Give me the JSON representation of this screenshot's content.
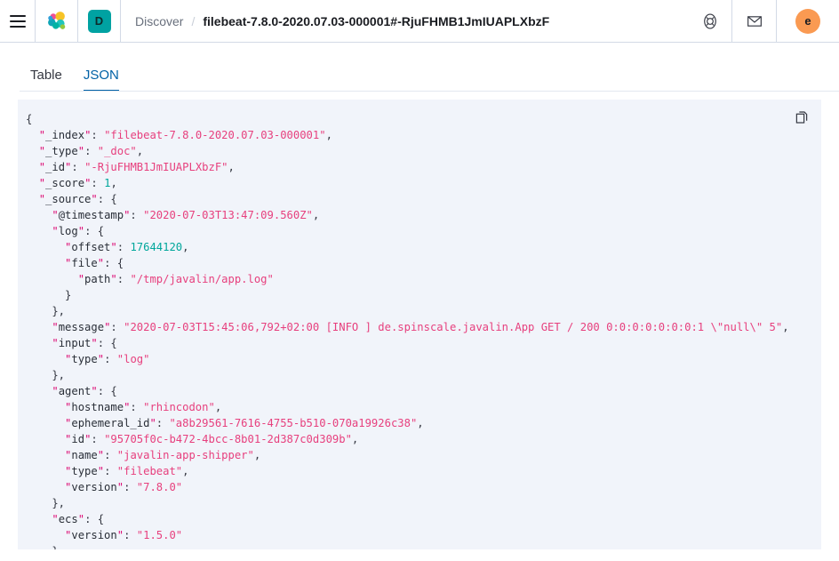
{
  "topbar": {
    "menu_label": "Toggle primary navigation",
    "logo_name": "elastic-logo",
    "space_badge": "D",
    "breadcrumb": {
      "parent": "Discover",
      "separator": "/",
      "current": "filebeat-7.8.0-2020.07.03-000001#-RjuFHMB1JmIUAPLXbzF"
    },
    "icons": [
      {
        "name": "help-lifebuoy-icon",
        "label": "Help"
      },
      {
        "name": "mail-envelope-icon",
        "label": "News feed"
      }
    ],
    "avatar": "e"
  },
  "tabs": [
    {
      "id": "table",
      "label": "Table",
      "active": false
    },
    {
      "id": "json",
      "label": "JSON",
      "active": true
    }
  ],
  "json_panel": {
    "copy_label": "Copy to clipboard",
    "copy_icon": "copy-icon",
    "document": {
      "_index": "filebeat-7.8.0-2020.07.03-000001",
      "_type": "_doc",
      "_id": "-RjuFHMB1JmIUAPLXbzF",
      "_score": 1,
      "_source": {
        "@timestamp": "2020-07-03T13:47:09.560Z",
        "log": {
          "offset": 17644120,
          "file": {
            "path": "/tmp/javalin/app.log"
          }
        },
        "message": "2020-07-03T15:45:06,792+02:00 [INFO ] de.spinscale.javalin.App GET / 200 0:0:0:0:0:0:0:1 \\\"null\\\" 5",
        "input": {
          "type": "log"
        },
        "agent": {
          "hostname": "rhincodon",
          "ephemeral_id": "a8b29561-7616-4755-b510-070a19926c38",
          "id": "95705f0c-b472-4bcc-8b01-2d387c0d309b",
          "name": "javalin-app-shipper",
          "type": "filebeat",
          "version": "7.8.0"
        },
        "ecs": {
          "version": "1.5.0"
        }
      }
    },
    "lines": [
      [
        {
          "t": "p",
          "v": "{"
        }
      ],
      [
        {
          "t": "p",
          "v": "  "
        },
        {
          "t": "q",
          "v": "\""
        },
        {
          "t": "k",
          "v": "_index"
        },
        {
          "t": "q",
          "v": "\""
        },
        {
          "t": "p",
          "v": ": "
        },
        {
          "t": "s",
          "v": "\"filebeat-7.8.0-2020.07.03-000001\""
        },
        {
          "t": "p",
          "v": ","
        }
      ],
      [
        {
          "t": "p",
          "v": "  "
        },
        {
          "t": "q",
          "v": "\""
        },
        {
          "t": "k",
          "v": "_type"
        },
        {
          "t": "q",
          "v": "\""
        },
        {
          "t": "p",
          "v": ": "
        },
        {
          "t": "s",
          "v": "\"_doc\""
        },
        {
          "t": "p",
          "v": ","
        }
      ],
      [
        {
          "t": "p",
          "v": "  "
        },
        {
          "t": "q",
          "v": "\""
        },
        {
          "t": "k",
          "v": "_id"
        },
        {
          "t": "q",
          "v": "\""
        },
        {
          "t": "p",
          "v": ": "
        },
        {
          "t": "s",
          "v": "\"-RjuFHMB1JmIUAPLXbzF\""
        },
        {
          "t": "p",
          "v": ","
        }
      ],
      [
        {
          "t": "p",
          "v": "  "
        },
        {
          "t": "q",
          "v": "\""
        },
        {
          "t": "k",
          "v": "_score"
        },
        {
          "t": "q",
          "v": "\""
        },
        {
          "t": "p",
          "v": ": "
        },
        {
          "t": "n",
          "v": "1"
        },
        {
          "t": "p",
          "v": ","
        }
      ],
      [
        {
          "t": "p",
          "v": "  "
        },
        {
          "t": "q",
          "v": "\""
        },
        {
          "t": "k",
          "v": "_source"
        },
        {
          "t": "q",
          "v": "\""
        },
        {
          "t": "p",
          "v": ": {"
        }
      ],
      [
        {
          "t": "p",
          "v": "    "
        },
        {
          "t": "q",
          "v": "\""
        },
        {
          "t": "k",
          "v": "@timestamp"
        },
        {
          "t": "q",
          "v": "\""
        },
        {
          "t": "p",
          "v": ": "
        },
        {
          "t": "s",
          "v": "\"2020-07-03T13:47:09.560Z\""
        },
        {
          "t": "p",
          "v": ","
        }
      ],
      [
        {
          "t": "p",
          "v": "    "
        },
        {
          "t": "q",
          "v": "\""
        },
        {
          "t": "k",
          "v": "log"
        },
        {
          "t": "q",
          "v": "\""
        },
        {
          "t": "p",
          "v": ": {"
        }
      ],
      [
        {
          "t": "p",
          "v": "      "
        },
        {
          "t": "q",
          "v": "\""
        },
        {
          "t": "k",
          "v": "offset"
        },
        {
          "t": "q",
          "v": "\""
        },
        {
          "t": "p",
          "v": ": "
        },
        {
          "t": "n",
          "v": "17644120"
        },
        {
          "t": "p",
          "v": ","
        }
      ],
      [
        {
          "t": "p",
          "v": "      "
        },
        {
          "t": "q",
          "v": "\""
        },
        {
          "t": "k",
          "v": "file"
        },
        {
          "t": "q",
          "v": "\""
        },
        {
          "t": "p",
          "v": ": {"
        }
      ],
      [
        {
          "t": "p",
          "v": "        "
        },
        {
          "t": "q",
          "v": "\""
        },
        {
          "t": "k",
          "v": "path"
        },
        {
          "t": "q",
          "v": "\""
        },
        {
          "t": "p",
          "v": ": "
        },
        {
          "t": "s",
          "v": "\"/tmp/javalin/app.log\""
        }
      ],
      [
        {
          "t": "p",
          "v": "      }"
        }
      ],
      [
        {
          "t": "p",
          "v": "    },"
        }
      ],
      [
        {
          "t": "p",
          "v": "    "
        },
        {
          "t": "q",
          "v": "\""
        },
        {
          "t": "k",
          "v": "message"
        },
        {
          "t": "q",
          "v": "\""
        },
        {
          "t": "p",
          "v": ": "
        },
        {
          "t": "s",
          "v": "\"2020-07-03T15:45:06,792+02:00 [INFO ] de.spinscale.javalin.App GET / 200 0:0:0:0:0:0:0:1 \\\"null\\\" 5\""
        },
        {
          "t": "p",
          "v": ","
        }
      ],
      [
        {
          "t": "p",
          "v": "    "
        },
        {
          "t": "q",
          "v": "\""
        },
        {
          "t": "k",
          "v": "input"
        },
        {
          "t": "q",
          "v": "\""
        },
        {
          "t": "p",
          "v": ": {"
        }
      ],
      [
        {
          "t": "p",
          "v": "      "
        },
        {
          "t": "q",
          "v": "\""
        },
        {
          "t": "k",
          "v": "type"
        },
        {
          "t": "q",
          "v": "\""
        },
        {
          "t": "p",
          "v": ": "
        },
        {
          "t": "s",
          "v": "\"log\""
        }
      ],
      [
        {
          "t": "p",
          "v": "    },"
        }
      ],
      [
        {
          "t": "p",
          "v": "    "
        },
        {
          "t": "q",
          "v": "\""
        },
        {
          "t": "k",
          "v": "agent"
        },
        {
          "t": "q",
          "v": "\""
        },
        {
          "t": "p",
          "v": ": {"
        }
      ],
      [
        {
          "t": "p",
          "v": "      "
        },
        {
          "t": "q",
          "v": "\""
        },
        {
          "t": "k",
          "v": "hostname"
        },
        {
          "t": "q",
          "v": "\""
        },
        {
          "t": "p",
          "v": ": "
        },
        {
          "t": "s",
          "v": "\"rhincodon\""
        },
        {
          "t": "p",
          "v": ","
        }
      ],
      [
        {
          "t": "p",
          "v": "      "
        },
        {
          "t": "q",
          "v": "\""
        },
        {
          "t": "k",
          "v": "ephemeral_id"
        },
        {
          "t": "q",
          "v": "\""
        },
        {
          "t": "p",
          "v": ": "
        },
        {
          "t": "s",
          "v": "\"a8b29561-7616-4755-b510-070a19926c38\""
        },
        {
          "t": "p",
          "v": ","
        }
      ],
      [
        {
          "t": "p",
          "v": "      "
        },
        {
          "t": "q",
          "v": "\""
        },
        {
          "t": "k",
          "v": "id"
        },
        {
          "t": "q",
          "v": "\""
        },
        {
          "t": "p",
          "v": ": "
        },
        {
          "t": "s",
          "v": "\"95705f0c-b472-4bcc-8b01-2d387c0d309b\""
        },
        {
          "t": "p",
          "v": ","
        }
      ],
      [
        {
          "t": "p",
          "v": "      "
        },
        {
          "t": "q",
          "v": "\""
        },
        {
          "t": "k",
          "v": "name"
        },
        {
          "t": "q",
          "v": "\""
        },
        {
          "t": "p",
          "v": ": "
        },
        {
          "t": "s",
          "v": "\"javalin-app-shipper\""
        },
        {
          "t": "p",
          "v": ","
        }
      ],
      [
        {
          "t": "p",
          "v": "      "
        },
        {
          "t": "q",
          "v": "\""
        },
        {
          "t": "k",
          "v": "type"
        },
        {
          "t": "q",
          "v": "\""
        },
        {
          "t": "p",
          "v": ": "
        },
        {
          "t": "s",
          "v": "\"filebeat\""
        },
        {
          "t": "p",
          "v": ","
        }
      ],
      [
        {
          "t": "p",
          "v": "      "
        },
        {
          "t": "q",
          "v": "\""
        },
        {
          "t": "k",
          "v": "version"
        },
        {
          "t": "q",
          "v": "\""
        },
        {
          "t": "p",
          "v": ": "
        },
        {
          "t": "s",
          "v": "\"7.8.0\""
        }
      ],
      [
        {
          "t": "p",
          "v": "    },"
        }
      ],
      [
        {
          "t": "p",
          "v": "    "
        },
        {
          "t": "q",
          "v": "\""
        },
        {
          "t": "k",
          "v": "ecs"
        },
        {
          "t": "q",
          "v": "\""
        },
        {
          "t": "p",
          "v": ": {"
        }
      ],
      [
        {
          "t": "p",
          "v": "      "
        },
        {
          "t": "q",
          "v": "\""
        },
        {
          "t": "k",
          "v": "version"
        },
        {
          "t": "q",
          "v": "\""
        },
        {
          "t": "p",
          "v": ": "
        },
        {
          "t": "s",
          "v": "\"1.5.0\""
        }
      ],
      [
        {
          "t": "p",
          "v": "    },"
        }
      ]
    ]
  },
  "colors": {
    "accent_blue": "#0061a6",
    "space_teal": "#00a2a2",
    "avatar_orange": "#fa9a52",
    "string_pink": "#e7407e",
    "number_teal": "#00a69b",
    "panel_bg": "#f1f4fa",
    "border": "#d3dae6"
  }
}
